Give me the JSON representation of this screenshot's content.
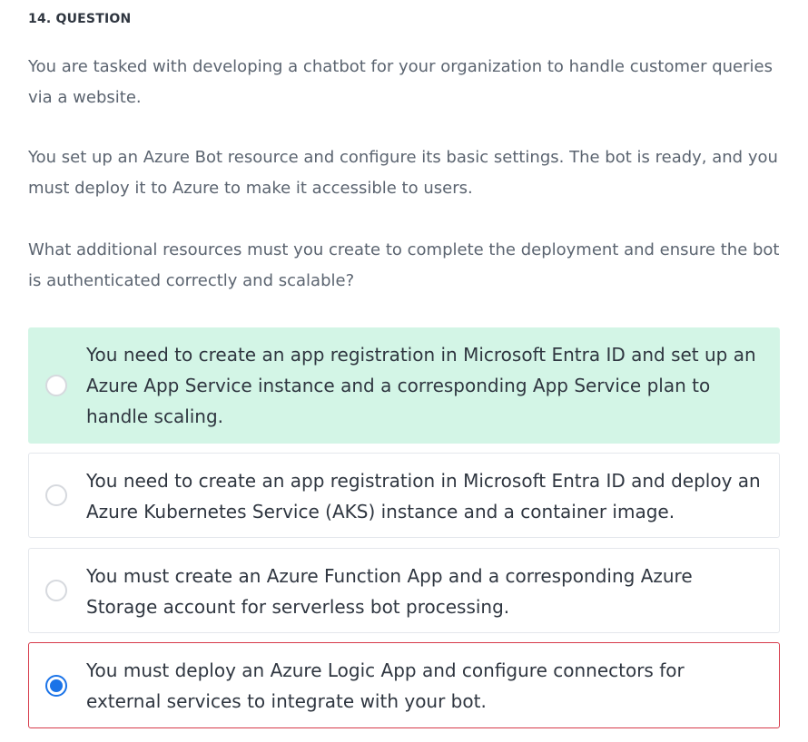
{
  "question": {
    "number_label": "14. QUESTION",
    "paragraphs": [
      "You are tasked with developing a chatbot for your organization to handle customer queries via a website.",
      "You set up an Azure Bot resource and configure its basic settings. The bot is ready, and you must deploy it to Azure to make it accessible to users.",
      "What additional resources must you create to complete the deployment and ensure the bot is authenticated correctly and scalable?"
    ],
    "options": [
      {
        "text": "You need to create an app registration in Microsoft Entra ID and set up an Azure App Service instance and a corresponding App Service plan to handle scaling.",
        "state": "correct",
        "selected": false
      },
      {
        "text": "You need to create an app registration in Microsoft Entra ID and deploy an Azure Kubernetes Service (AKS) instance and a container image.",
        "state": "neutral",
        "selected": false
      },
      {
        "text": "You must create an Azure Function App and a corresponding Azure Storage account for serverless bot processing.",
        "state": "neutral",
        "selected": false
      },
      {
        "text": "You must deploy an Azure Logic App and configure connectors for external services to integrate with your bot.",
        "state": "incorrect",
        "selected": true
      }
    ]
  },
  "colors": {
    "correct_bg": "#d3f5e6",
    "incorrect_border": "#d73a4a",
    "radio_selected": "#1a73e8"
  }
}
